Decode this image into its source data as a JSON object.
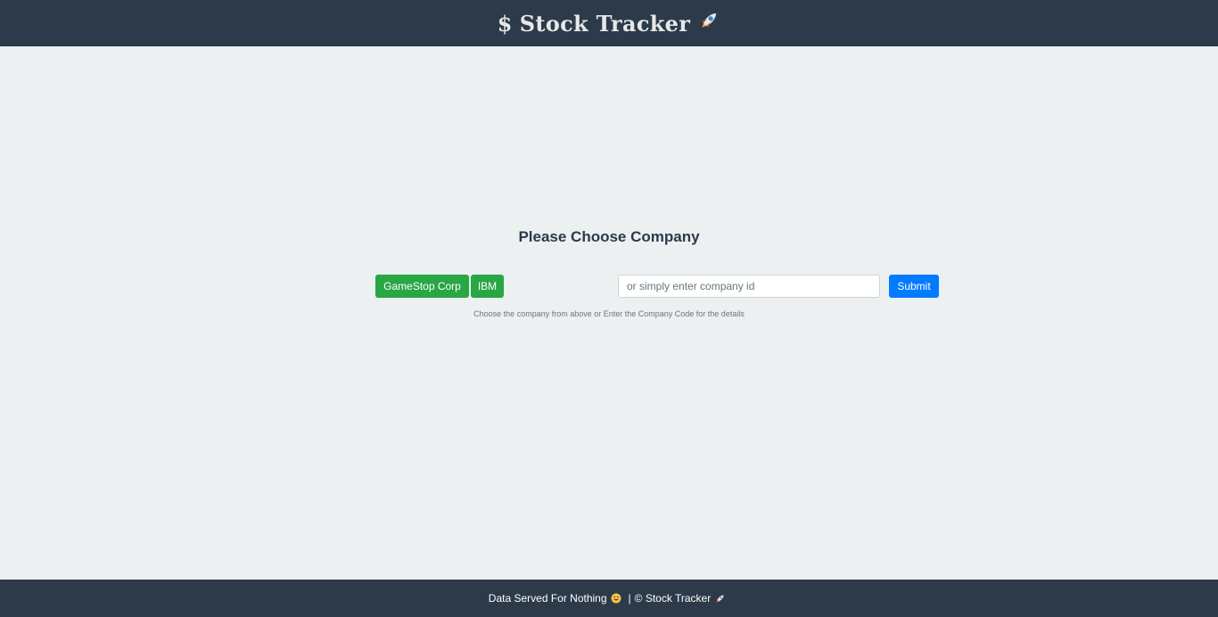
{
  "header": {
    "title_prefix": "$",
    "title_text": "Stock Tracker"
  },
  "main": {
    "heading": "Please Choose Company",
    "company_buttons": [
      "GameStop Corp",
      "IBM"
    ],
    "search": {
      "placeholder": "or simply enter company id",
      "value": ""
    },
    "submit_label": "Submit",
    "help_text": "Choose the company from above or Enter the Company Code for the details"
  },
  "footer": {
    "text_left": "Data Served For Nothing",
    "separator": "|",
    "copyright": "© Stock Tracker"
  },
  "icons": {
    "title_icon": "rocket-icon",
    "footer_icon_1": "grinning-face-icon",
    "footer_icon_2": "rocket-icon"
  },
  "colors": {
    "header_bg": "#2c3a4a",
    "page_bg": "#ecf0f1",
    "success": "#28a745",
    "primary": "#007bff"
  }
}
